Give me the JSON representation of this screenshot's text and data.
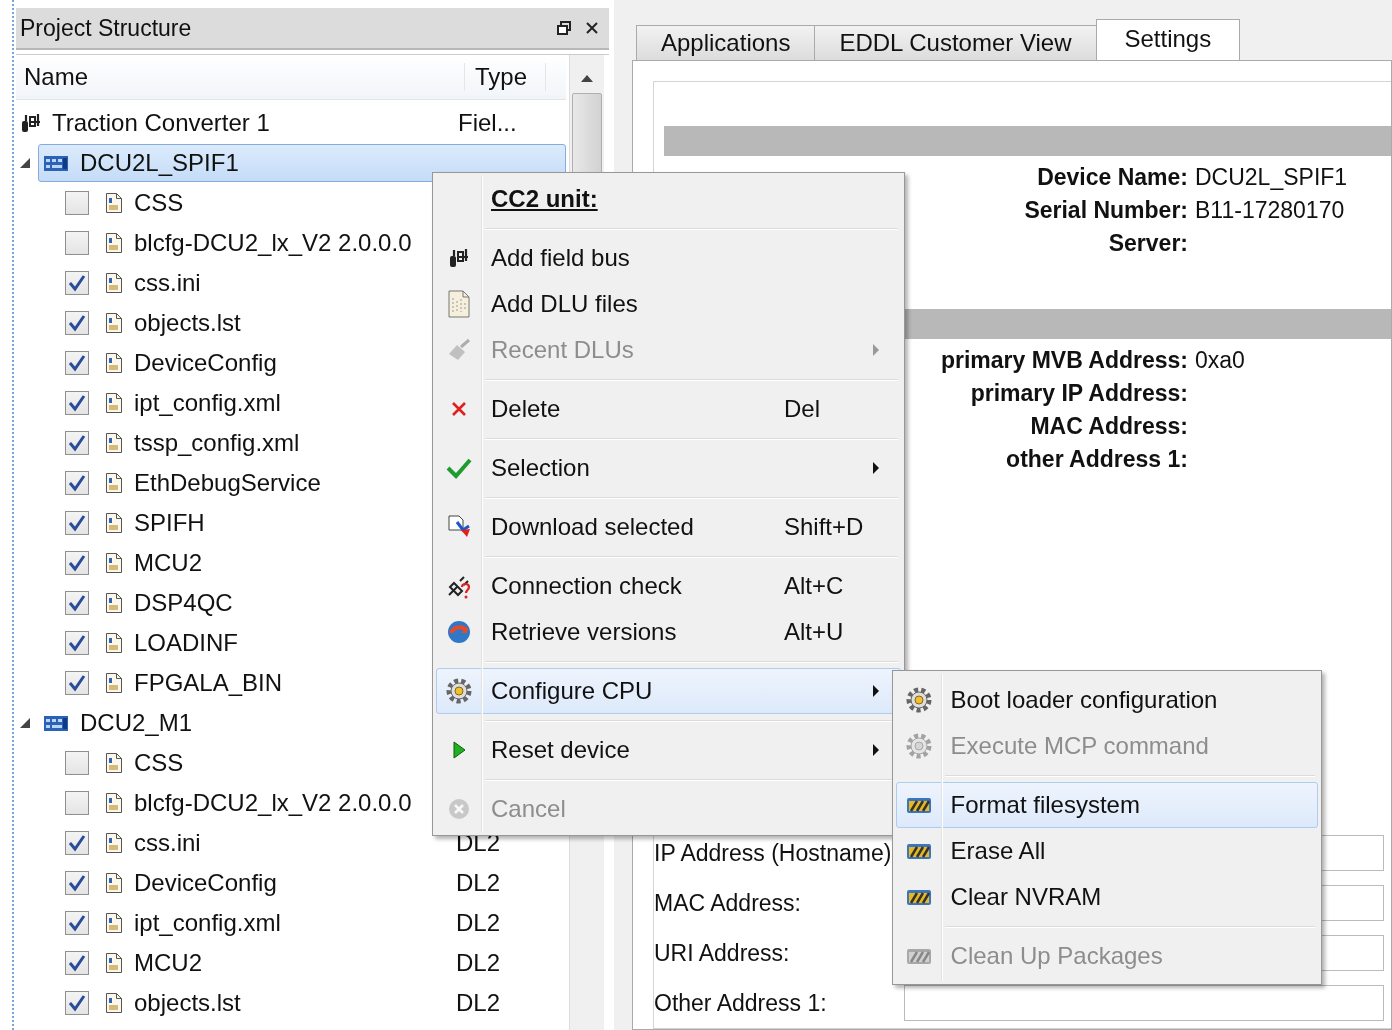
{
  "project_panel": {
    "title": "Project Structure",
    "columns": [
      "Name",
      "Type"
    ],
    "tree": [
      {
        "label": "Traction Converter 1",
        "type": "Fiel...",
        "children": [
          {
            "label": "DCU2L_SPIF1",
            "expanded": true,
            "selected": true,
            "children": [
              {
                "label": "CSS",
                "checked": false
              },
              {
                "label": "blcfg-DCU2_lx_V2 2.0.0.0",
                "checked": false
              },
              {
                "label": "css.ini",
                "checked": true
              },
              {
                "label": "objects.lst",
                "checked": true
              },
              {
                "label": "DeviceConfig",
                "checked": true
              },
              {
                "label": "ipt_config.xml",
                "checked": true
              },
              {
                "label": "tssp_config.xml",
                "checked": true
              },
              {
                "label": "EthDebugService",
                "checked": true
              },
              {
                "label": "SPIFH",
                "checked": true
              },
              {
                "label": "MCU2",
                "checked": true
              },
              {
                "label": "DSP4QC",
                "checked": true
              },
              {
                "label": "LOADINF",
                "checked": true
              },
              {
                "label": "FPGALA_BIN",
                "checked": true
              }
            ]
          },
          {
            "label": "DCU2_M1",
            "expanded": true,
            "selected": false,
            "children": [
              {
                "label": "CSS",
                "checked": false
              },
              {
                "label": "blcfg-DCU2_lx_V2 2.0.0.0",
                "checked": false
              },
              {
                "label": "css.ini",
                "checked": true,
                "type": "DL2"
              },
              {
                "label": "DeviceConfig",
                "checked": true,
                "type": "DL2"
              },
              {
                "label": "ipt_config.xml",
                "checked": true,
                "type": "DL2"
              },
              {
                "label": "MCU2",
                "checked": true,
                "type": "DL2"
              },
              {
                "label": "objects.lst",
                "checked": true,
                "type": "DL2"
              }
            ]
          }
        ]
      }
    ]
  },
  "tabs": [
    {
      "label": "Applications",
      "selected": false
    },
    {
      "label": "EDDL Customer View",
      "selected": false
    },
    {
      "label": "Settings",
      "selected": true
    }
  ],
  "device_info": [
    {
      "label": "Device Name:",
      "value": "DCU2L_SPIF1"
    },
    {
      "label": "Serial Number:",
      "value": "B11-17280170"
    },
    {
      "label": "Server:"
    }
  ],
  "address_info": [
    {
      "label": "primary MVB Address:",
      "value": "0xa0"
    },
    {
      "label": "primary IP Address:"
    },
    {
      "label": "MAC Address:"
    },
    {
      "label": "other Address 1:"
    }
  ],
  "connection_fields": [
    {
      "label": "IP Address (Hostname)"
    },
    {
      "label": "MAC Address:"
    },
    {
      "label": "URI Address:"
    },
    {
      "label": "Other Address 1:"
    }
  ],
  "context_menu": {
    "items": [
      {
        "kind": "header",
        "label": "CC2 unit:"
      },
      {
        "kind": "separator"
      },
      {
        "kind": "item",
        "label": "Add field bus",
        "disabled": false,
        "selected": false,
        "submenu": false
      },
      {
        "kind": "item",
        "label": "Add DLU files",
        "disabled": false,
        "selected": false,
        "submenu": false
      },
      {
        "kind": "item",
        "label": "Recent DLUs",
        "disabled": true,
        "selected": false,
        "submenu": true
      },
      {
        "kind": "separator"
      },
      {
        "kind": "item",
        "label": "Delete",
        "shortcut": "Del",
        "disabled": false,
        "selected": false,
        "submenu": false
      },
      {
        "kind": "separator"
      },
      {
        "kind": "item",
        "label": "Selection",
        "disabled": false,
        "selected": false,
        "submenu": true
      },
      {
        "kind": "separator"
      },
      {
        "kind": "item",
        "label": "Download selected",
        "shortcut": "Shift+D",
        "disabled": false,
        "selected": false,
        "submenu": false
      },
      {
        "kind": "separator"
      },
      {
        "kind": "item",
        "label": "Connection check",
        "shortcut": "Alt+C",
        "disabled": false,
        "selected": false,
        "submenu": false
      },
      {
        "kind": "item",
        "label": "Retrieve versions",
        "shortcut": "Alt+U",
        "disabled": false,
        "selected": false,
        "submenu": false
      },
      {
        "kind": "separator"
      },
      {
        "kind": "item",
        "label": "Configure CPU",
        "disabled": false,
        "selected": true,
        "submenu": true
      },
      {
        "kind": "separator"
      },
      {
        "kind": "item",
        "label": "Reset device",
        "disabled": false,
        "selected": false,
        "submenu": true
      },
      {
        "kind": "separator"
      },
      {
        "kind": "item",
        "label": "Cancel",
        "disabled": true,
        "selected": false,
        "submenu": false
      }
    ]
  },
  "submenu": {
    "items": [
      {
        "kind": "item",
        "label": "Boot loader configuration",
        "disabled": false,
        "selected": false
      },
      {
        "kind": "item",
        "label": "Execute MCP command",
        "disabled": true,
        "selected": false
      },
      {
        "kind": "separator"
      },
      {
        "kind": "item",
        "label": "Format filesystem",
        "disabled": false,
        "selected": true
      },
      {
        "kind": "item",
        "label": "Erase All",
        "disabled": false,
        "selected": false
      },
      {
        "kind": "item",
        "label": "Clear NVRAM",
        "disabled": false,
        "selected": false
      },
      {
        "kind": "separator"
      },
      {
        "kind": "item",
        "label": "Clean Up Packages",
        "disabled": true,
        "selected": false
      }
    ]
  }
}
